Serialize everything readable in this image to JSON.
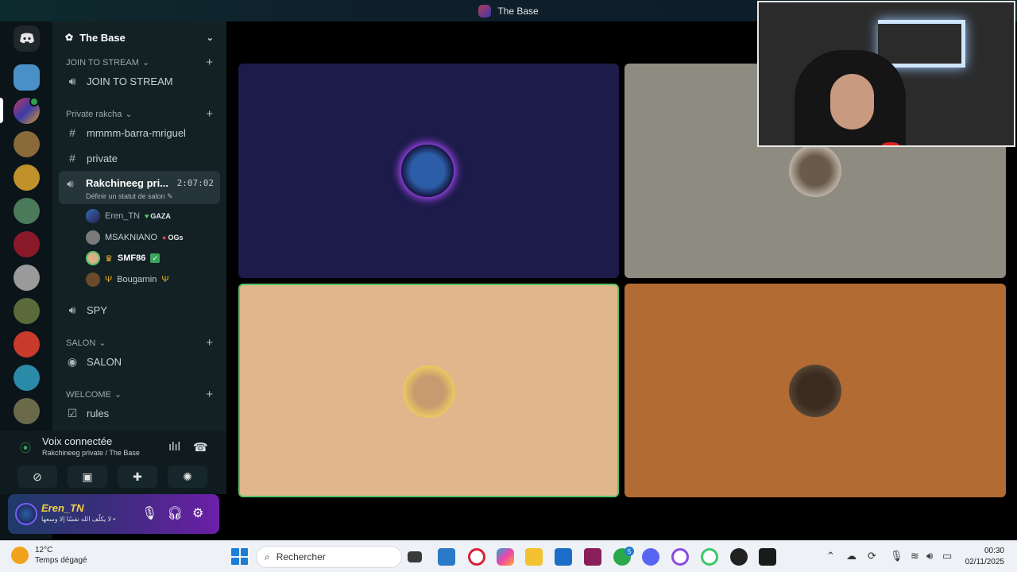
{
  "window": {
    "title": "The Base"
  },
  "server": {
    "name": "The Base"
  },
  "channels": {
    "cat_join": "JOIN TO STREAM",
    "join_stream": "JOIN TO STREAM",
    "cat_private": "Private rakcha",
    "mmmm": "mmmm-barra-mriguel",
    "private": "private",
    "active_name": "Rakchineeg pri...",
    "active_time": "2:07:02",
    "active_sub": "Définir un statut de salon",
    "spy": "SPY",
    "cat_salon": "SALON",
    "salon": "SALON",
    "cat_welcome": "WELCOME",
    "rules": "rules"
  },
  "members": [
    {
      "name": "Eren_TN",
      "tag": "GAZA",
      "tag_icon": "green-heart-icon"
    },
    {
      "name": "MSAKNIANO",
      "tag": "OGs",
      "tag_icon": "red-apple-icon"
    },
    {
      "name": "SMF86",
      "tag": "",
      "tag_icon": "check-icon",
      "prefix_icon": "crown-icon"
    },
    {
      "name": "Bougarnin",
      "tag": "",
      "tag_icon": "trident-icon",
      "prefix_icon": "trident-icon"
    }
  ],
  "voice": {
    "status": "Voix connectée",
    "location": "Rakchineeg private / The Base"
  },
  "user": {
    "name": "Eren_TN",
    "status": "لا يكلّف الله نفسًا إلا وسعها •"
  },
  "taskbar": {
    "temp": "12°C",
    "weather": "Temps dégagé",
    "search_placeholder": "Rechercher",
    "time": "00:30",
    "date": "02/11/2025",
    "xbox_badge": "5"
  },
  "colors": {
    "tile1": "#1c1b4a",
    "tile2": "#8e8b80",
    "tile3": "#e0b68c",
    "tile4": "#b26b32",
    "speaking": "#57c46a"
  }
}
